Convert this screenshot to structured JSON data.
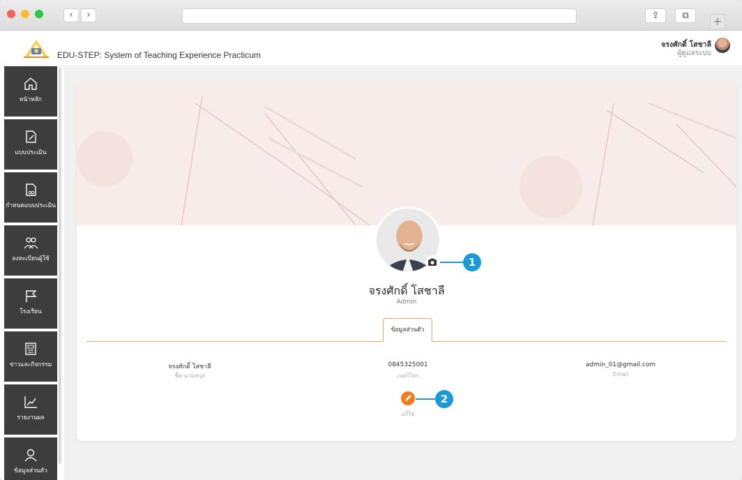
{
  "app": {
    "title": "EDU-STEP: System of Teaching Experience Practicum",
    "user_name": "จรงศักดิ์ โสชาลี",
    "user_role": "ผู้ดูแลระบบ"
  },
  "browser": {
    "back": "‹",
    "forward": "›",
    "share": "⇪",
    "tabs": "⧉",
    "new_tab": "+"
  },
  "sidebar": {
    "items": [
      {
        "label": "หน้าหลัก",
        "icon": "home-icon"
      },
      {
        "label": "แบบประเมิน",
        "icon": "document-edit-icon"
      },
      {
        "label": "กำหนดแบบประเมิน",
        "icon": "document-link-icon"
      },
      {
        "label": "ลงทะเบียนผู้ใช้",
        "icon": "users-icon"
      },
      {
        "label": "โรงเรียน",
        "icon": "flag-icon"
      },
      {
        "label": "ข่าวและกิจกรรม",
        "icon": "newspaper-icon"
      },
      {
        "label": "รายงานผล",
        "icon": "chart-icon"
      },
      {
        "label": "ข้อมูลส่วนตัว",
        "icon": "profile-icon"
      }
    ]
  },
  "profile": {
    "name": "จรงศักดิ์ โสชาลี",
    "role": "Admin",
    "tab": "ข้อมูลส่วนตัว",
    "fields": [
      {
        "value": "จรงศักดิ์ โสชาลี",
        "label": "ชื่อ-นามสกุล"
      },
      {
        "value": "0845325001",
        "label": "เบอร์โทร"
      },
      {
        "value": "admin_01@gmail.com",
        "label": "Email"
      }
    ],
    "edit_label": "แก้ไข"
  },
  "callouts": {
    "one": "1",
    "two": "2"
  },
  "colors": {
    "accent": "#f07d1b",
    "callout": "#1a9bd7",
    "sidebar": "#3d3d3d"
  }
}
